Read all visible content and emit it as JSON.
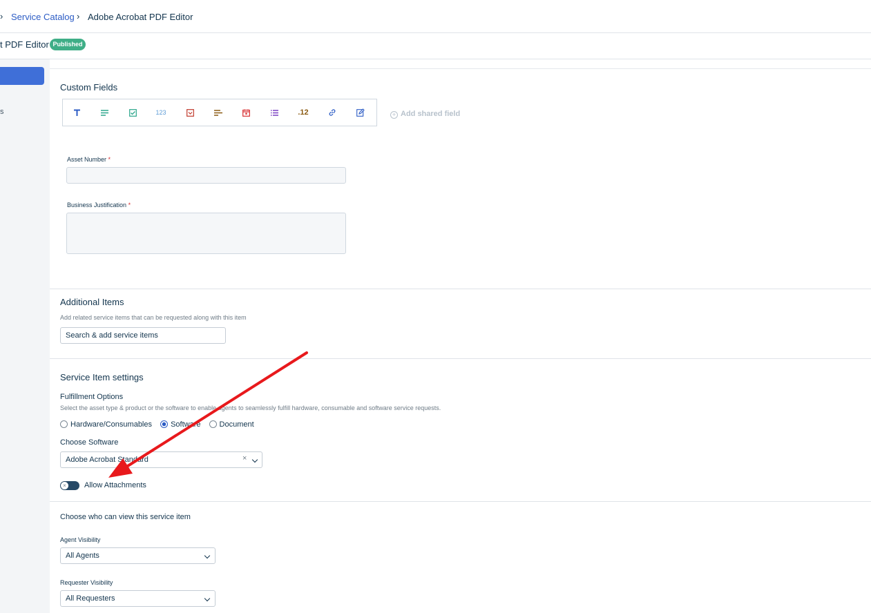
{
  "breadcrumb": {
    "chevron": "›",
    "parent": "Service Catalog",
    "separator": "›",
    "current": "Adobe Acrobat PDF Editor"
  },
  "item_header": {
    "title_fragment": "t PDF Editor",
    "status_badge": "Published"
  },
  "sidebar": {
    "item_fragment": "s"
  },
  "custom_fields": {
    "title": "Custom Fields",
    "toolbar_icons": [
      "text-icon",
      "paragraph-icon",
      "checkbox-icon",
      "number-icon",
      "dropdown-icon",
      "dependent-field-icon",
      "date-icon",
      "multi-select-icon",
      "decimal-icon",
      "url-icon",
      "content-icon"
    ],
    "number_glyph": "123",
    "decimal_glyph": ".12",
    "add_shared_icon": "+",
    "add_shared": "Add shared field",
    "asset_number_label": "Asset Number",
    "business_justification_label": "Business Justification",
    "required_mark": "*"
  },
  "additional_items": {
    "title": "Additional Items",
    "description": "Add related service items that can be requested along with this item",
    "search_value": "Search & add service items"
  },
  "settings": {
    "title": "Service Item settings",
    "fulfillment_title": "Fulfillment Options",
    "fulfillment_desc": "Select the asset type & product or the software to enable agents to seamlessly fulfill hardware, consumable and software service requests.",
    "options": [
      "Hardware/Consumables",
      "Software",
      "Document"
    ],
    "selected_option": "Software",
    "choose_software_label": "Choose Software",
    "software_value": "Adobe Acrobat Standard",
    "clear_glyph": "×",
    "toggle_glyph": "×",
    "allow_attachments": "Allow Attachments",
    "allow_attachments_on": false
  },
  "visibility": {
    "title": "Choose who can view this service item",
    "agent_label": "Agent Visibility",
    "agent_value": "All Agents",
    "requester_label": "Requester Visibility",
    "requester_value": "All Requesters"
  },
  "colors": {
    "accent": "#2c5cc5",
    "published": "#3fae87",
    "annotation_arrow": "#e8191c"
  }
}
